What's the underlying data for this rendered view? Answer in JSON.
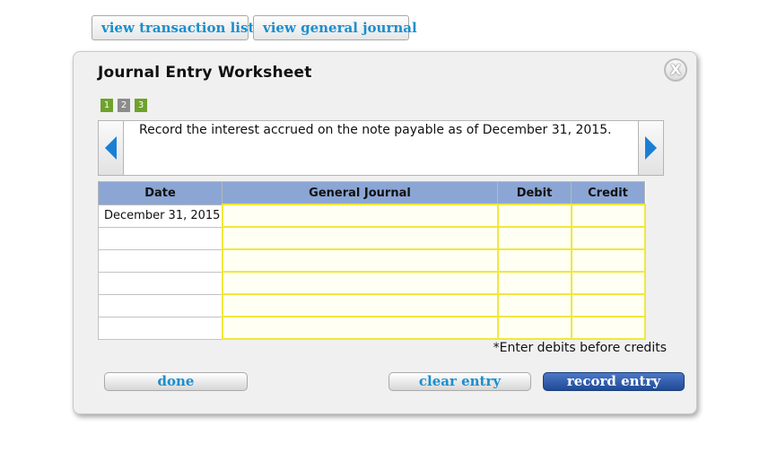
{
  "top_buttons": {
    "transaction_list": "view transaction list",
    "general_journal": "view general journal"
  },
  "worksheet": {
    "title": "Journal Entry Worksheet",
    "close_label": "X",
    "steps": [
      "1",
      "2",
      "3"
    ],
    "description": "Record the interest accrued on the note payable as of December 31, 2015."
  },
  "table": {
    "headers": {
      "date": "Date",
      "general_journal": "General Journal",
      "debit": "Debit",
      "credit": "Credit"
    },
    "rows": [
      {
        "date": "December 31, 2015",
        "account": "",
        "debit": "",
        "credit": ""
      },
      {
        "date": "",
        "account": "",
        "debit": "",
        "credit": ""
      },
      {
        "date": "",
        "account": "",
        "debit": "",
        "credit": ""
      },
      {
        "date": "",
        "account": "",
        "debit": "",
        "credit": ""
      },
      {
        "date": "",
        "account": "",
        "debit": "",
        "credit": ""
      },
      {
        "date": "",
        "account": "",
        "debit": "",
        "credit": ""
      }
    ]
  },
  "note": "*Enter debits before credits",
  "actions": {
    "done": "done",
    "clear_entry": "clear entry",
    "record_entry": "record entry"
  },
  "colors": {
    "header_bg": "#8ba6d4",
    "input_border": "#f0e83a",
    "step_active": "#6fa22c",
    "step_inactive": "#8c8c8c",
    "link_blue": "#1a8fcf",
    "record_button": "#1f4a96"
  }
}
